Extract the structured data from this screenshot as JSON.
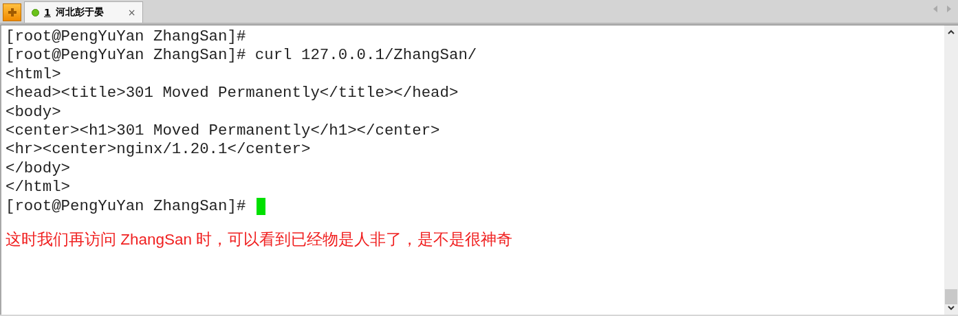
{
  "tabs": [
    {
      "number": "1",
      "title": "河北彭于晏",
      "close": "×",
      "selected": true
    }
  ],
  "terminal": {
    "lines": [
      "[root@PengYuYan ZhangSan]#",
      "[root@PengYuYan ZhangSan]# curl 127.0.0.1/ZhangSan/",
      "<html>",
      "<head><title>301 Moved Permanently</title></head>",
      "<body>",
      "<center><h1>301 Moved Permanently</h1></center>",
      "<hr><center>nginx/1.20.1</center>",
      "</body>",
      "</html>"
    ],
    "prompt": "[root@PengYuYan ZhangSan]#",
    "annotation": "这时我们再访问 ZhangSan 时，可以看到已经物是人非了，是不是很神奇"
  }
}
